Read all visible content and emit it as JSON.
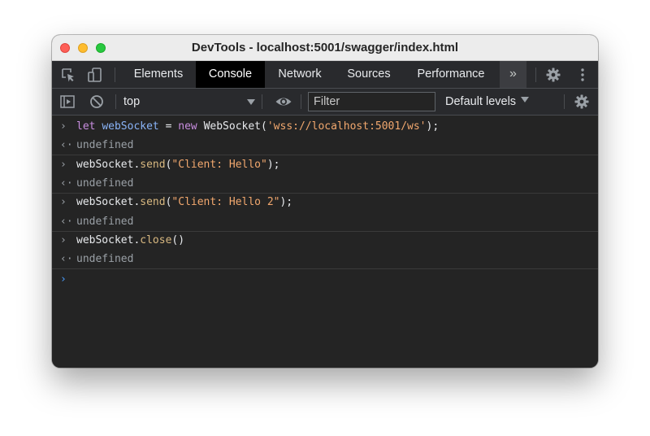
{
  "window": {
    "title": "DevTools - localhost:5001/swagger/index.html"
  },
  "tabs": [
    {
      "label": "Elements",
      "active": false
    },
    {
      "label": "Console",
      "active": true
    },
    {
      "label": "Network",
      "active": false
    },
    {
      "label": "Sources",
      "active": false
    },
    {
      "label": "Performance",
      "active": false
    }
  ],
  "tabbar": {
    "more_glyph": "»"
  },
  "toolbar": {
    "context": "top",
    "filter_placeholder": "Filter",
    "levels": "Default levels"
  },
  "console": {
    "entries": [
      {
        "type": "input",
        "prompt": "›",
        "tokens": [
          {
            "t": "let ",
            "c": "kw"
          },
          {
            "t": "webSocket",
            "c": "var"
          },
          {
            "t": " = ",
            "c": "plain"
          },
          {
            "t": "new ",
            "c": "kw"
          },
          {
            "t": "WebSocket(",
            "c": "plain"
          },
          {
            "t": "'wss://localhost:5001/ws'",
            "c": "str"
          },
          {
            "t": ");",
            "c": "plain"
          }
        ]
      },
      {
        "type": "output",
        "prompt": "‹·",
        "tokens": [
          {
            "t": "undefined",
            "c": "undef"
          }
        ]
      },
      {
        "type": "input",
        "prompt": "›",
        "tokens": [
          {
            "t": "webSocket.",
            "c": "plain"
          },
          {
            "t": "send",
            "c": "fn"
          },
          {
            "t": "(",
            "c": "plain"
          },
          {
            "t": "\"Client: Hello\"",
            "c": "str"
          },
          {
            "t": ");",
            "c": "plain"
          }
        ]
      },
      {
        "type": "output",
        "prompt": "‹·",
        "tokens": [
          {
            "t": "undefined",
            "c": "undef"
          }
        ]
      },
      {
        "type": "input",
        "prompt": "›",
        "tokens": [
          {
            "t": "webSocket.",
            "c": "plain"
          },
          {
            "t": "send",
            "c": "fn"
          },
          {
            "t": "(",
            "c": "plain"
          },
          {
            "t": "\"Client: Hello 2\"",
            "c": "str"
          },
          {
            "t": ");",
            "c": "plain"
          }
        ]
      },
      {
        "type": "output",
        "prompt": "‹·",
        "tokens": [
          {
            "t": "undefined",
            "c": "undef"
          }
        ]
      },
      {
        "type": "input",
        "prompt": "›",
        "tokens": [
          {
            "t": "webSocket.",
            "c": "plain"
          },
          {
            "t": "close",
            "c": "fn"
          },
          {
            "t": "()",
            "c": "plain"
          }
        ]
      },
      {
        "type": "output",
        "prompt": "‹·",
        "tokens": [
          {
            "t": "undefined",
            "c": "undef"
          }
        ]
      }
    ],
    "active_prompt": "›"
  },
  "icons": {
    "inspect": "inspect-element-icon",
    "device": "device-toolbar-icon",
    "settings": "gear-icon",
    "menu": "kebab-menu-icon",
    "sidebar": "show-sidebar-icon",
    "clear": "clear-console-icon",
    "eye": "live-expression-icon"
  },
  "colors": {
    "keyword": "#c98ee0",
    "variable": "#8ab4f8",
    "function": "#d8b880",
    "string": "#f2a86e",
    "undefined": "#9aa0a6",
    "active_prompt": "#4a9eff"
  }
}
